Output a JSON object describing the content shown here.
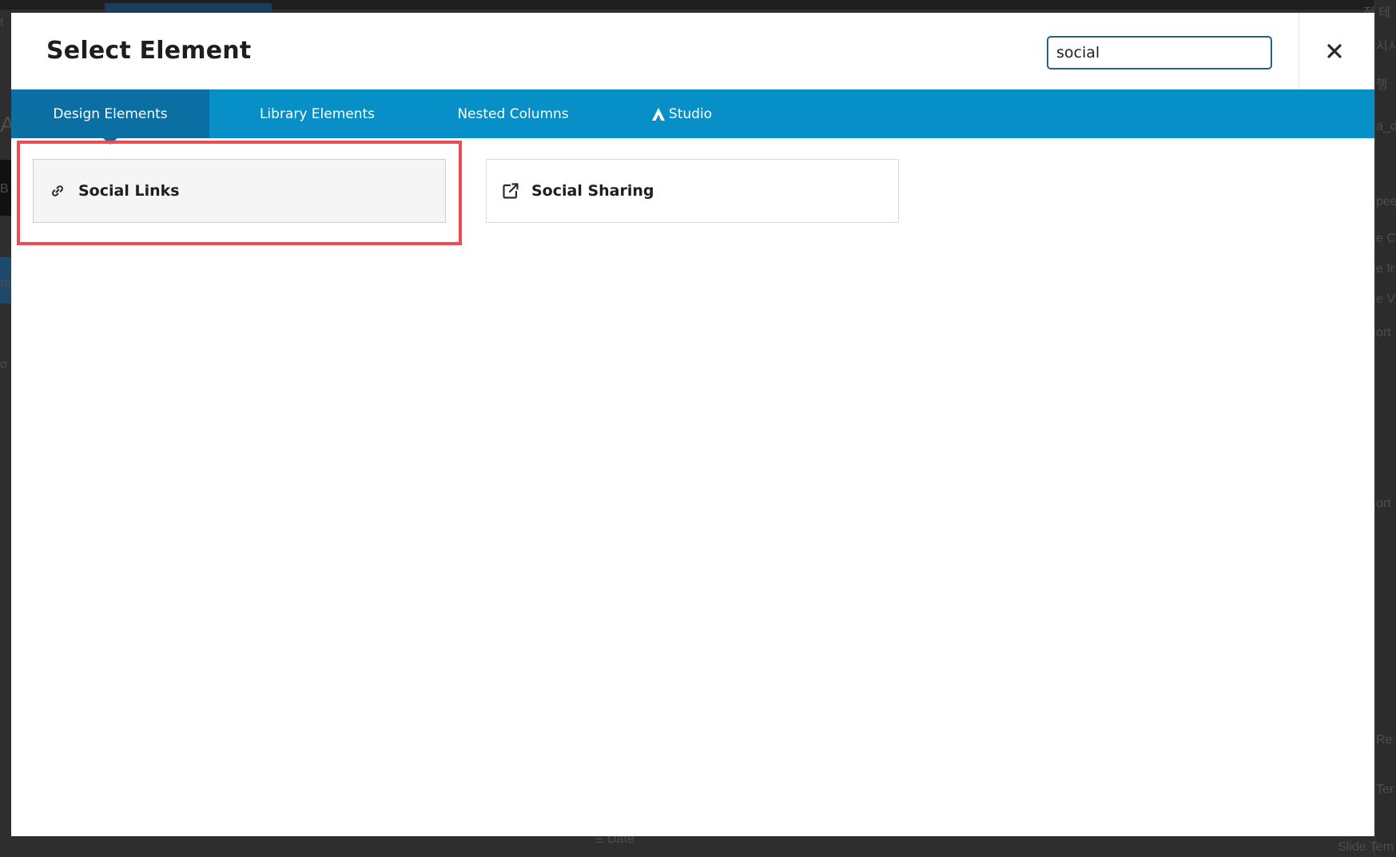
{
  "modal": {
    "title": "Select Element",
    "search": {
      "value": "social",
      "placeholder": ""
    }
  },
  "tabs": [
    {
      "label": "Design Elements",
      "active": true
    },
    {
      "label": "Library Elements",
      "active": false
    },
    {
      "label": "Nested Columns",
      "active": false
    },
    {
      "label": "Studio",
      "active": false,
      "icon": "studio-logo-icon"
    }
  ],
  "elements": [
    {
      "label": "Social Links",
      "icon": "link-icon",
      "highlighted": true
    },
    {
      "label": "Social Sharing",
      "icon": "external-link-icon",
      "highlighted": false
    }
  ],
  "background": {
    "bottom_label": "Date",
    "right_fragments": [
      "정 테",
      "시시",
      "행",
      "a_o",
      "pee",
      "e C",
      "e Ir",
      "e V",
      "ort",
      "ort",
      "Re",
      "Ter",
      "Slide Tem"
    ],
    "left_fragments": [
      "t",
      "A",
      "B",
      "te",
      "o"
    ]
  },
  "colors": {
    "tab_bar": "#0790c8",
    "tab_active": "#0b6fa3",
    "highlight": "#f04a52",
    "search_border": "#2a5f86"
  }
}
